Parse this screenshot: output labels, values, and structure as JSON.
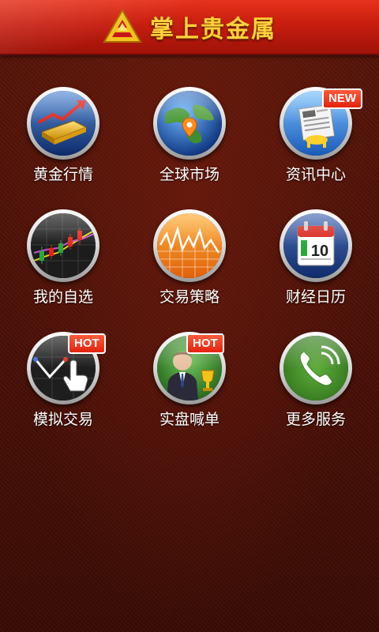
{
  "header": {
    "title": "掌上贵金属",
    "logo_icon": "gold-ingot-logo-icon",
    "logo_color": "#ffd23a"
  },
  "colors": {
    "header_red": "#d4261a",
    "background": "#4a1208",
    "badge": "#e2230e"
  },
  "menu": {
    "items": [
      {
        "label": "黄金行情",
        "icon": "gold-bar-chart-icon"
      },
      {
        "label": "全球市场",
        "icon": "globe-icon"
      },
      {
        "label": "资讯中心",
        "icon": "newspaper-icon",
        "badge": "NEW"
      },
      {
        "label": "我的自选",
        "icon": "candlestick-chart-icon"
      },
      {
        "label": "交易策略",
        "icon": "strategy-chart-icon"
      },
      {
        "label": "财经日历",
        "icon": "calendar-icon"
      },
      {
        "label": "模拟交易",
        "icon": "touch-chart-icon",
        "badge": "HOT"
      },
      {
        "label": "实盘喊单",
        "icon": "trader-trophy-icon",
        "badge": "HOT"
      },
      {
        "label": "更多服务",
        "icon": "phone-icon"
      }
    ]
  }
}
